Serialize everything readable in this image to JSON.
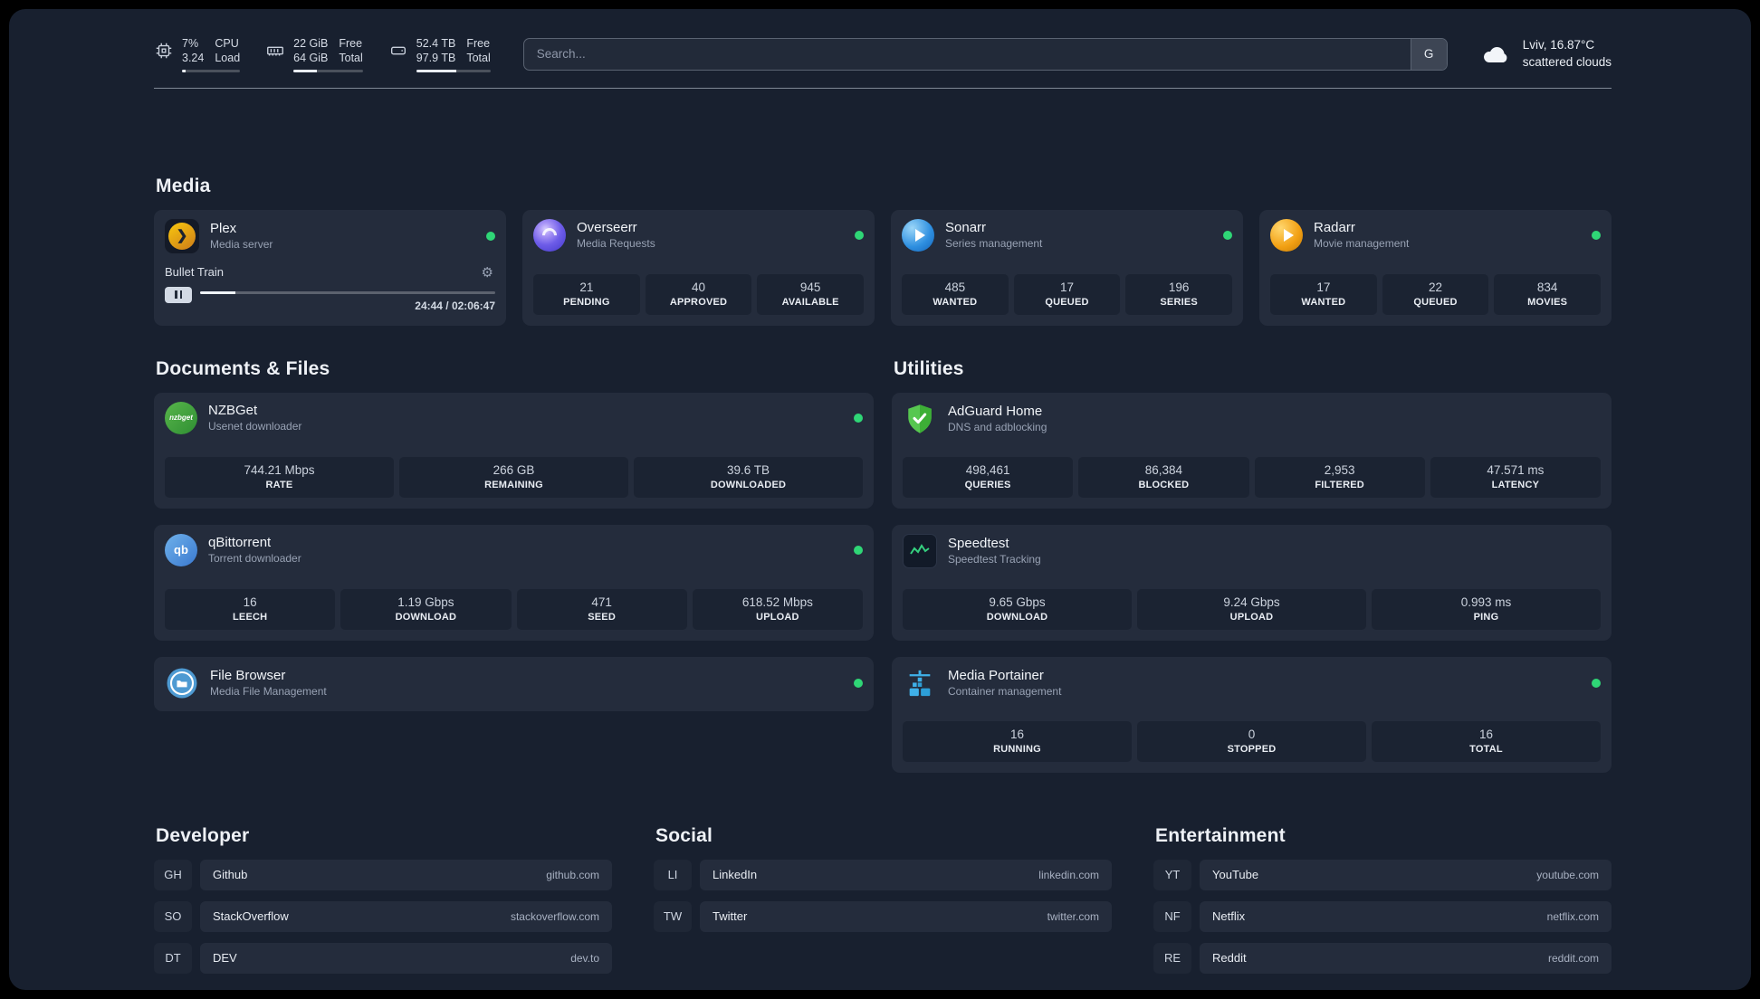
{
  "colors": {
    "status_online": "#2fd676"
  },
  "topbar": {
    "cpu": {
      "percent": "7%",
      "load": "3.24",
      "label_top": "CPU",
      "label_bottom": "Load",
      "bar_percent": 7
    },
    "memory": {
      "free": "22 GiB",
      "total": "64 GiB",
      "label_top": "Free",
      "label_bottom": "Total",
      "bar_percent": 34
    },
    "disk": {
      "free": "52.4 TB",
      "total": "97.9 TB",
      "label_top": "Free",
      "label_bottom": "Total",
      "bar_percent": 54
    },
    "search": {
      "placeholder": "Search...",
      "provider_button": "G"
    },
    "weather": {
      "location": "Lviv, 16.87°C",
      "condition": "scattered clouds"
    }
  },
  "sections": {
    "media": {
      "title": "Media",
      "plex": {
        "name": "Plex",
        "description": "Media server",
        "now_playing": "Bullet Train",
        "elapsed_total": "24:44 / 02:06:47",
        "progress_percent": 12
      },
      "overseerr": {
        "name": "Overseerr",
        "description": "Media Requests",
        "stats": [
          {
            "value": "21",
            "label": "PENDING"
          },
          {
            "value": "40",
            "label": "APPROVED"
          },
          {
            "value": "945",
            "label": "AVAILABLE"
          }
        ]
      },
      "sonarr": {
        "name": "Sonarr",
        "description": "Series management",
        "stats": [
          {
            "value": "485",
            "label": "WANTED"
          },
          {
            "value": "17",
            "label": "QUEUED"
          },
          {
            "value": "196",
            "label": "SERIES"
          }
        ]
      },
      "radarr": {
        "name": "Radarr",
        "description": "Movie management",
        "stats": [
          {
            "value": "17",
            "label": "WANTED"
          },
          {
            "value": "22",
            "label": "QUEUED"
          },
          {
            "value": "834",
            "label": "MOVIES"
          }
        ]
      }
    },
    "documents": {
      "title": "Documents & Files",
      "nzbget": {
        "name": "NZBGet",
        "description": "Usenet downloader",
        "stats": [
          {
            "value": "744.21 Mbps",
            "label": "RATE"
          },
          {
            "value": "266 GB",
            "label": "REMAINING"
          },
          {
            "value": "39.6 TB",
            "label": "DOWNLOADED"
          }
        ]
      },
      "qbittorrent": {
        "name": "qBittorrent",
        "description": "Torrent downloader",
        "stats": [
          {
            "value": "16",
            "label": "LEECH"
          },
          {
            "value": "1.19 Gbps",
            "label": "DOWNLOAD"
          },
          {
            "value": "471",
            "label": "SEED"
          },
          {
            "value": "618.52 Mbps",
            "label": "UPLOAD"
          }
        ]
      },
      "filebrowser": {
        "name": "File Browser",
        "description": "Media File Management"
      }
    },
    "utilities": {
      "title": "Utilities",
      "adguard": {
        "name": "AdGuard Home",
        "description": "DNS and adblocking",
        "stats": [
          {
            "value": "498,461",
            "label": "QUERIES"
          },
          {
            "value": "86,384",
            "label": "BLOCKED"
          },
          {
            "value": "2,953",
            "label": "FILTERED"
          },
          {
            "value": "47.571 ms",
            "label": "LATENCY"
          }
        ]
      },
      "speedtest": {
        "name": "Speedtest",
        "description": "Speedtest Tracking",
        "stats": [
          {
            "value": "9.65 Gbps",
            "label": "DOWNLOAD"
          },
          {
            "value": "9.24 Gbps",
            "label": "UPLOAD"
          },
          {
            "value": "0.993 ms",
            "label": "PING"
          }
        ]
      },
      "portainer": {
        "name": "Media Portainer",
        "description": "Container management",
        "stats": [
          {
            "value": "16",
            "label": "RUNNING"
          },
          {
            "value": "0",
            "label": "STOPPED"
          },
          {
            "value": "16",
            "label": "TOTAL"
          }
        ]
      }
    }
  },
  "bookmarks": {
    "developer": {
      "title": "Developer",
      "items": [
        {
          "abbr": "GH",
          "name": "Github",
          "url": "github.com"
        },
        {
          "abbr": "SO",
          "name": "StackOverflow",
          "url": "stackoverflow.com"
        },
        {
          "abbr": "DT",
          "name": "DEV",
          "url": "dev.to"
        }
      ]
    },
    "social": {
      "title": "Social",
      "items": [
        {
          "abbr": "LI",
          "name": "LinkedIn",
          "url": "linkedin.com"
        },
        {
          "abbr": "TW",
          "name": "Twitter",
          "url": "twitter.com"
        }
      ]
    },
    "entertainment": {
      "title": "Entertainment",
      "items": [
        {
          "abbr": "YT",
          "name": "YouTube",
          "url": "youtube.com"
        },
        {
          "abbr": "NF",
          "name": "Netflix",
          "url": "netflix.com"
        },
        {
          "abbr": "RE",
          "name": "Reddit",
          "url": "reddit.com"
        }
      ]
    }
  },
  "icons": {
    "plex_glyph": "❯",
    "gear": "⚙",
    "qbittorrent_text": "qb",
    "nzbget_text": "nzbget"
  }
}
